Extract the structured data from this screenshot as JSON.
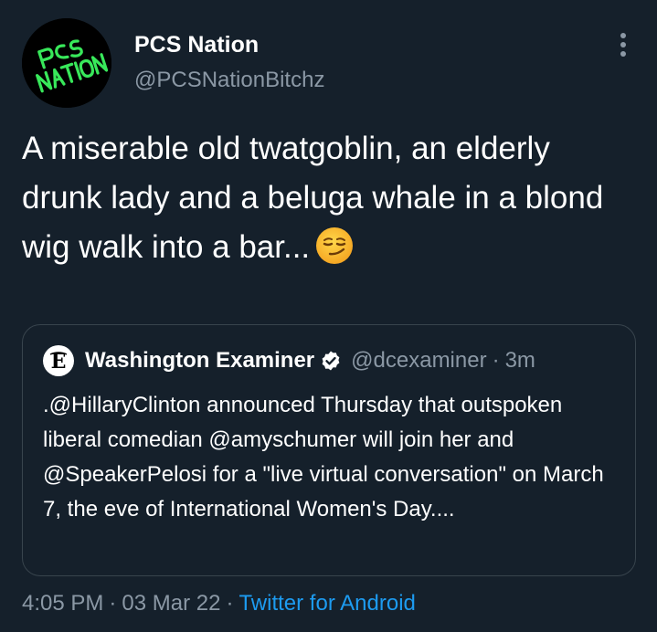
{
  "colors": {
    "background": "#15202b",
    "text": "#ffffff",
    "secondary_text": "#8b98a5",
    "link": "#1d9bf0",
    "border": "#38444d",
    "avatar_text": "#38e85a"
  },
  "tweet": {
    "author": {
      "display_name": "PCS Nation",
      "handle": "@PCSNationBitchz",
      "avatar_text": "PCS NATION"
    },
    "text": "A miserable old twatgoblin, an elderly drunk lady and a beluga whale in a blond wig walk into a bar...",
    "emoji": "smirking-face-emoji",
    "quoted": {
      "display_name": "Washington Examiner",
      "verified": true,
      "handle": "@dcexaminer",
      "dot": "·",
      "time": "3m",
      "text": ".@HillaryClinton announced Thursday that outspoken liberal comedian @amyschumer will join her and @SpeakerPelosi for a \"live virtual conversation\" on March 7, the eve of International Women's Day...."
    },
    "meta": {
      "time": "4:05 PM",
      "separator": "·",
      "date": "03 Mar 22",
      "source": "Twitter for Android"
    }
  },
  "icons": {
    "more": "more-vertical-icon",
    "verified": "verified-badge-icon",
    "quoted_avatar": "washington-examiner-logo"
  }
}
